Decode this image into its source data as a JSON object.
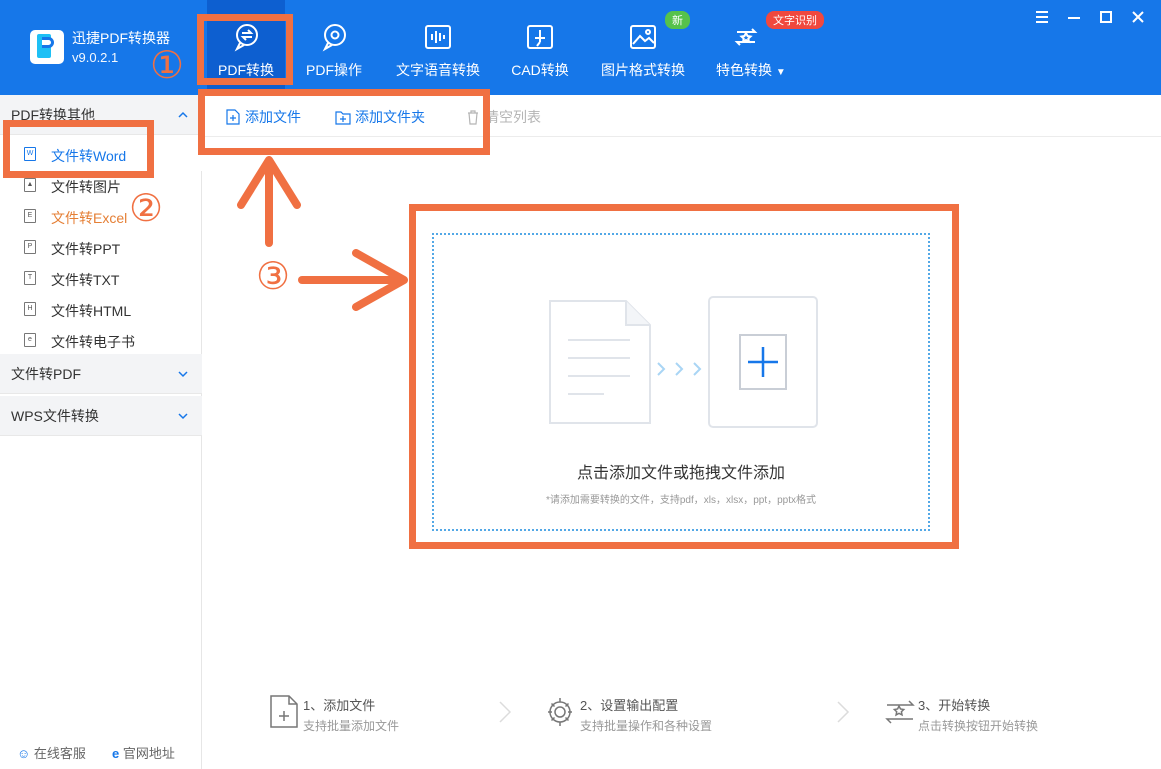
{
  "app": {
    "name": "迅捷PDF转换器",
    "version": "v9.0.2.1"
  },
  "nav": [
    {
      "label": "PDF转换",
      "icon": "pdf-convert-icon",
      "active": true
    },
    {
      "label": "PDF操作",
      "icon": "pdf-operate-icon",
      "active": false
    },
    {
      "label": "文字语音转换",
      "icon": "voice-icon",
      "active": false
    },
    {
      "label": "CAD转换",
      "icon": "cad-icon",
      "active": false
    },
    {
      "label": "图片格式转换",
      "icon": "image-icon",
      "active": false
    },
    {
      "label": "特色转换",
      "icon": "special-icon",
      "active": false
    }
  ],
  "badges": {
    "new": "新",
    "ocr": "文字识别"
  },
  "sidebar": {
    "section1": "PDF转换其他",
    "items": [
      {
        "label": "文件转Word",
        "icon_letter": "W"
      },
      {
        "label": "文件转图片",
        "icon_letter": "▲"
      },
      {
        "label": "文件转Excel",
        "icon_letter": "E"
      },
      {
        "label": "文件转PPT",
        "icon_letter": "P"
      },
      {
        "label": "文件转TXT",
        "icon_letter": "T"
      },
      {
        "label": "文件转HTML",
        "icon_letter": "H"
      },
      {
        "label": "文件转电子书",
        "icon_letter": "e"
      }
    ],
    "section2": "文件转PDF",
    "section3": "WPS文件转换",
    "footer": {
      "service": "在线客服",
      "website": "官网地址"
    }
  },
  "toolbar": {
    "add_file": "添加文件",
    "add_folder": "添加文件夹",
    "clear_list": "清空列表"
  },
  "dropzone": {
    "title": "点击添加文件或拖拽文件添加",
    "subtitle": "*请添加需要转换的文件，支持pdf，xls，xlsx，ppt，pptx格式"
  },
  "steps": [
    {
      "title": "1、添加文件",
      "desc": "支持批量添加文件"
    },
    {
      "title": "2、设置输出配置",
      "desc": "支持批量操作和各种设置"
    },
    {
      "title": "3、开始转换",
      "desc": "点击转换按钮开始转换"
    }
  ],
  "annotations": {
    "n1": "①",
    "n2": "②",
    "n3": "③"
  },
  "colors": {
    "brand": "#1677e9",
    "annotation": "#f07042",
    "highlight_text": "#e57f35"
  }
}
